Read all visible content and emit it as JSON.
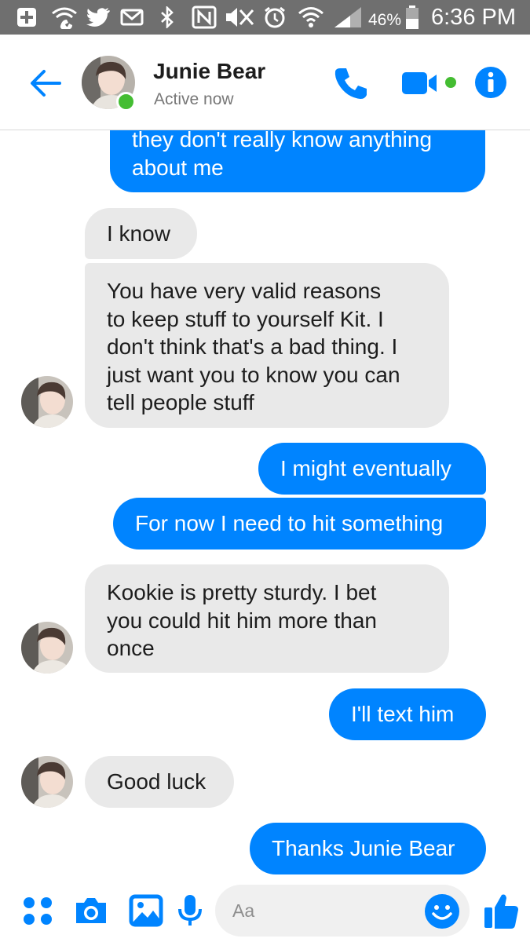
{
  "status_bar": {
    "battery_percent": "46%",
    "time": "6:36 PM",
    "icons": [
      "plus-box-icon",
      "wifi-calling-icon",
      "twitter-icon",
      "mail-icon",
      "bluetooth-icon",
      "nfc-icon",
      "mute-icon",
      "alarm-icon",
      "wifi-icon",
      "signal-icon",
      "battery-icon"
    ]
  },
  "header": {
    "contact_name": "Junie Bear",
    "contact_status": "Active now",
    "icons": [
      "back-arrow-icon",
      "phone-icon",
      "video-camera-icon",
      "info-icon"
    ],
    "accent_color": "#0084ff",
    "presence_color": "#44bd32"
  },
  "messages": [
    {
      "direction": "outgoing",
      "text": "they don't really know anything\nabout me"
    },
    {
      "direction": "incoming",
      "text": "I know"
    },
    {
      "direction": "incoming",
      "text": "You have very valid reasons\nto keep stuff to yourself Kit. I\ndon't think that's a bad thing. I\njust want you to know you can\ntell people stuff"
    },
    {
      "direction": "outgoing",
      "text": "I might eventually"
    },
    {
      "direction": "outgoing",
      "text": "For now I need to hit something"
    },
    {
      "direction": "incoming",
      "text": "Kookie is pretty sturdy. I bet\nyou could hit him more than\nonce"
    },
    {
      "direction": "outgoing",
      "text": "I'll text him"
    },
    {
      "direction": "incoming",
      "text": "Good luck"
    },
    {
      "direction": "outgoing",
      "text": "Thanks Junie Bear"
    }
  ],
  "colors": {
    "outgoing_bubble": "#0084ff",
    "incoming_bubble": "#e9e9e9",
    "status_bar": "#6f6f6f"
  },
  "composer": {
    "placeholder": "Aa",
    "icons": [
      "apps-grid-icon",
      "camera-icon",
      "image-icon",
      "microphone-icon",
      "emoji-icon",
      "thumbs-up-icon"
    ]
  }
}
